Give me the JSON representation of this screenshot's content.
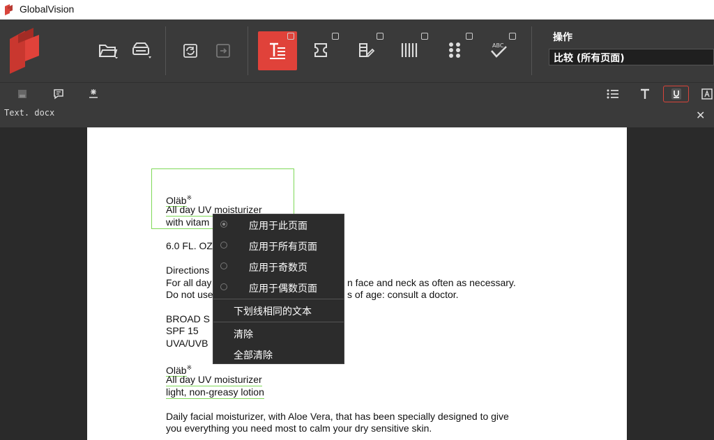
{
  "window": {
    "title": "GlobalVision"
  },
  "toolbar": {
    "operations_label": "操作",
    "operations_value": "比较 (所有页面)"
  },
  "tab": {
    "filename": "Text. docx"
  },
  "document": {
    "lines": [
      "Oläb",
      "All day UV moisturizer",
      "with vitam",
      "6.0 FL. OZ",
      "Directions",
      "For all day",
      "n face and neck as often as necessary.",
      "Do not use",
      "s of age: consult a doctor.",
      "BROAD S",
      "SPF 15",
      "UVA/UVB",
      "Oläb",
      "All day UV moisturizer",
      "light, non-greasy lotion",
      "Daily facial moisturizer, with Aloe Vera, that has been specially designed to give",
      "you everything you need most to calm your dry sensitive skin."
    ],
    "trademark": "※"
  },
  "context_menu": {
    "items": [
      "应用于此页面",
      "应用于所有页面",
      "应用于奇数页",
      "应用于偶数页面",
      "下划线相同的文本",
      "清除",
      "全部清除"
    ]
  },
  "colors": {
    "accent": "#e0423a",
    "highlight": "#7ed957"
  }
}
